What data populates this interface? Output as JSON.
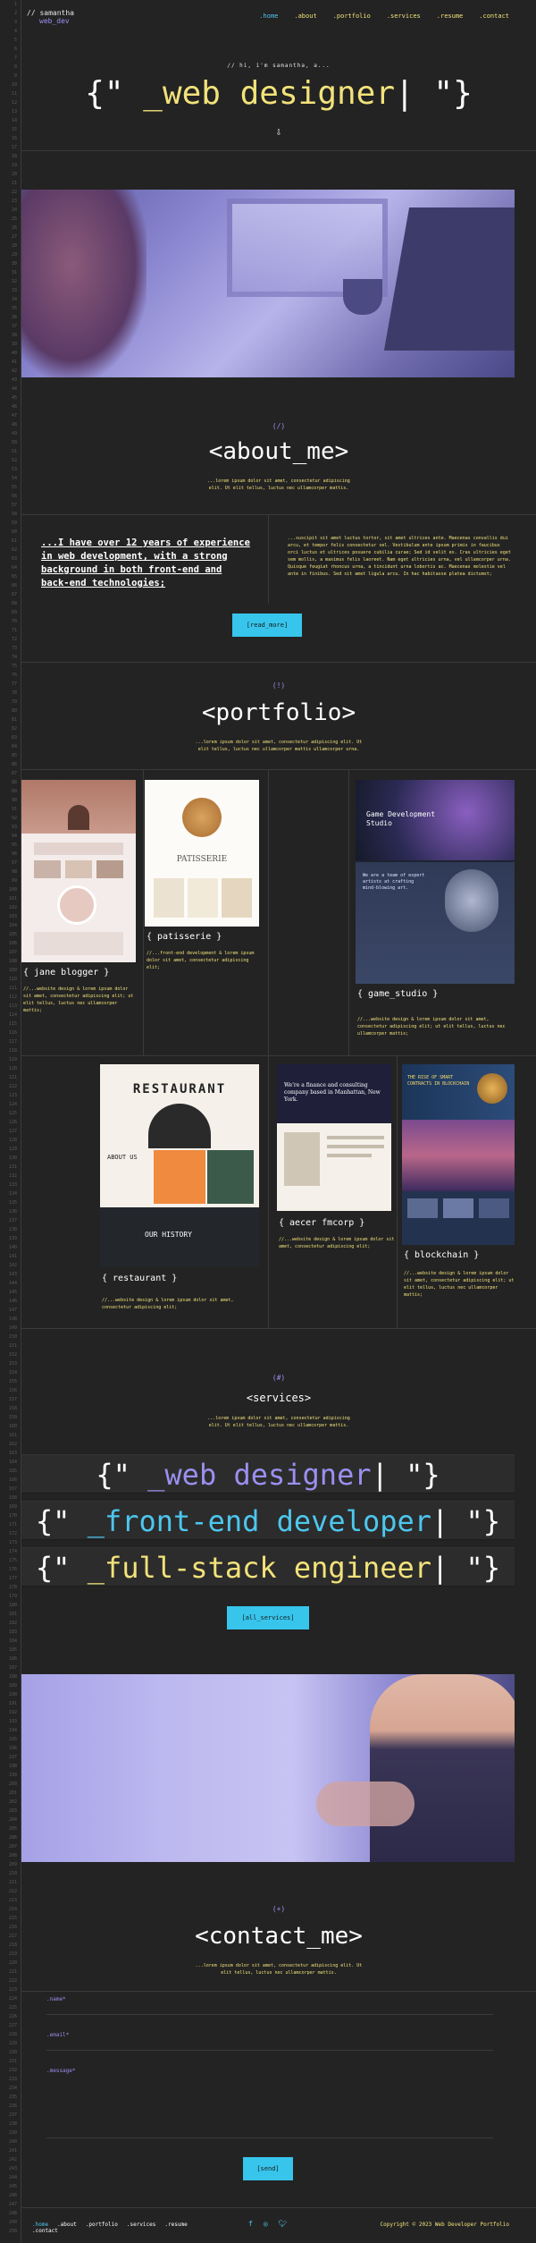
{
  "header": {
    "name_prefix": "// samantha",
    "name_role": "web_dev",
    "nav": [
      ".home",
      ".about",
      ".portfolio",
      ".services",
      ".resume",
      ".contact"
    ]
  },
  "hero": {
    "hello": "// hi, i'm samantha, a...",
    "open": "{\"",
    "title": " _web designer",
    "cursor": "|",
    "close": " \"}",
    "arrow": "⇩"
  },
  "about": {
    "num": "(/)",
    "title": "<about_me>",
    "subtitle": "...lorem ipsum dolor sit amet, consectetur adipiscing elit. Ut elit tellus, luctus nec ullamcorper mattis.",
    "quote": "...I have over 12 years of experience in web development, with a strong background in both front-end and back-end technologies;",
    "text": "...suscipit sit amet luctus tortor, sit amet ultrices ante. Maecenas convallis dui arcu, et tempor felis consectetur vel. Vestibulum ante ipsum primis in faucibus orci luctus et ultrices posuere cubilia curae; Sed id velit ex. Cras ultricies eget sem mollis, a maximus felis laoreet. Nam eget ultricies urna, vel ullamcorper urna. Quisque feugiat rhoncus urna, a tincidunt urna lobortis ac. Maecenas molestie vel ante in finibus. Sed sit amet ligula arcu. In hac habitasse platea dictumst;",
    "button": "[read_more]"
  },
  "portfolio": {
    "num": "(!)",
    "title": "<portfolio>",
    "subtitle": "...lorem ipsum dolor sit amet, consectetur adipiscing elit. Ut elit tellus, luctus nec ullamcorper mattis ullamcorper urna.",
    "items": [
      {
        "title": "{ jane blogger }",
        "desc": "//...website design & lorem ipsum dolor sit amet, consectetur adipiscing elit; ut elit tellus, luctus nec ullamcorper mattis;"
      },
      {
        "title": "{ patisserie }",
        "desc": "//...front-end development & lorem ipsum dolor sit amet, consectetur adipiscing elit;"
      },
      {
        "title": "{ game_studio }",
        "desc": "//...website design & lorem ipsum dolor sit amet, consectetur adipiscing elit; ut elit tellus, luctus nec ullamcorper mattis;"
      },
      {
        "title": "{ restaurant }",
        "desc": "//...website design & lorem ipsum dolor sit amet, consectetur adipiscing elit;"
      },
      {
        "title": "{ aecer fmcorp }",
        "desc": "//...website design & lorem ipsum dolor sit amet, consectetur adipiscing elit;"
      },
      {
        "title": "{ blockchain }",
        "desc": "//...website design & lorem ipsum dolor sit amet, consectetur adipiscing elit; ut elit tellus, luctus nec ullamcorper mattis;"
      }
    ],
    "thumb_text": {
      "patisserie": "PATISSERIE",
      "game": "Game Development Studio",
      "game_body": "We are a team of expert artists at crafting mind-blowing art.",
      "restaurant": "RESTAURANT",
      "about_us": "ABOUT US",
      "our_history": "OUR HISTORY",
      "finance": "We're a finance and consulting company based in Manhattan, New York.",
      "blockchain": "THE RISE OF SMART CONTRACTS IN BLOCKCHAIN"
    }
  },
  "services": {
    "num": "(#)",
    "title": "<services>",
    "subtitle": "...lorem ipsum dolor sit amet, consectetur adipiscing elit. Ut elit tellus, luctus nec ullamcorper mattis.",
    "lines": [
      {
        "open": "{\"",
        "text": " _web designer",
        "cursor": "|",
        "close": " \"}"
      },
      {
        "open": "{\"",
        "text": " _front-end developer",
        "cursor": "|",
        "close": " \"}"
      },
      {
        "open": "{\"",
        "text": " _full-stack engineer",
        "cursor": "|",
        "close": " \"}"
      }
    ],
    "button": "[all_services]"
  },
  "contact": {
    "num": "(+)",
    "title": "<contact_me>",
    "subtitle": "...lorem ipsum dolor sit amet, consectetur adipiscing elit. Ut elit tellus, luctus nec ullamcorper mattis.",
    "fields": [
      ".name*",
      ".email*",
      ".message*"
    ],
    "button": "[send]"
  },
  "footer": {
    "nav": [
      ".home",
      ".about",
      ".portfolio",
      ".services",
      ".resume",
      ".contact"
    ],
    "social": [
      "facebook-icon",
      "instagram-icon",
      "twitter-icon"
    ],
    "copyright": "Copyright © 2023 Web Developer Portfolio"
  },
  "colors": {
    "background": "#232323",
    "yellow": "#f2e27a",
    "cyan": "#37c5ec",
    "purple": "#9a90f0"
  }
}
